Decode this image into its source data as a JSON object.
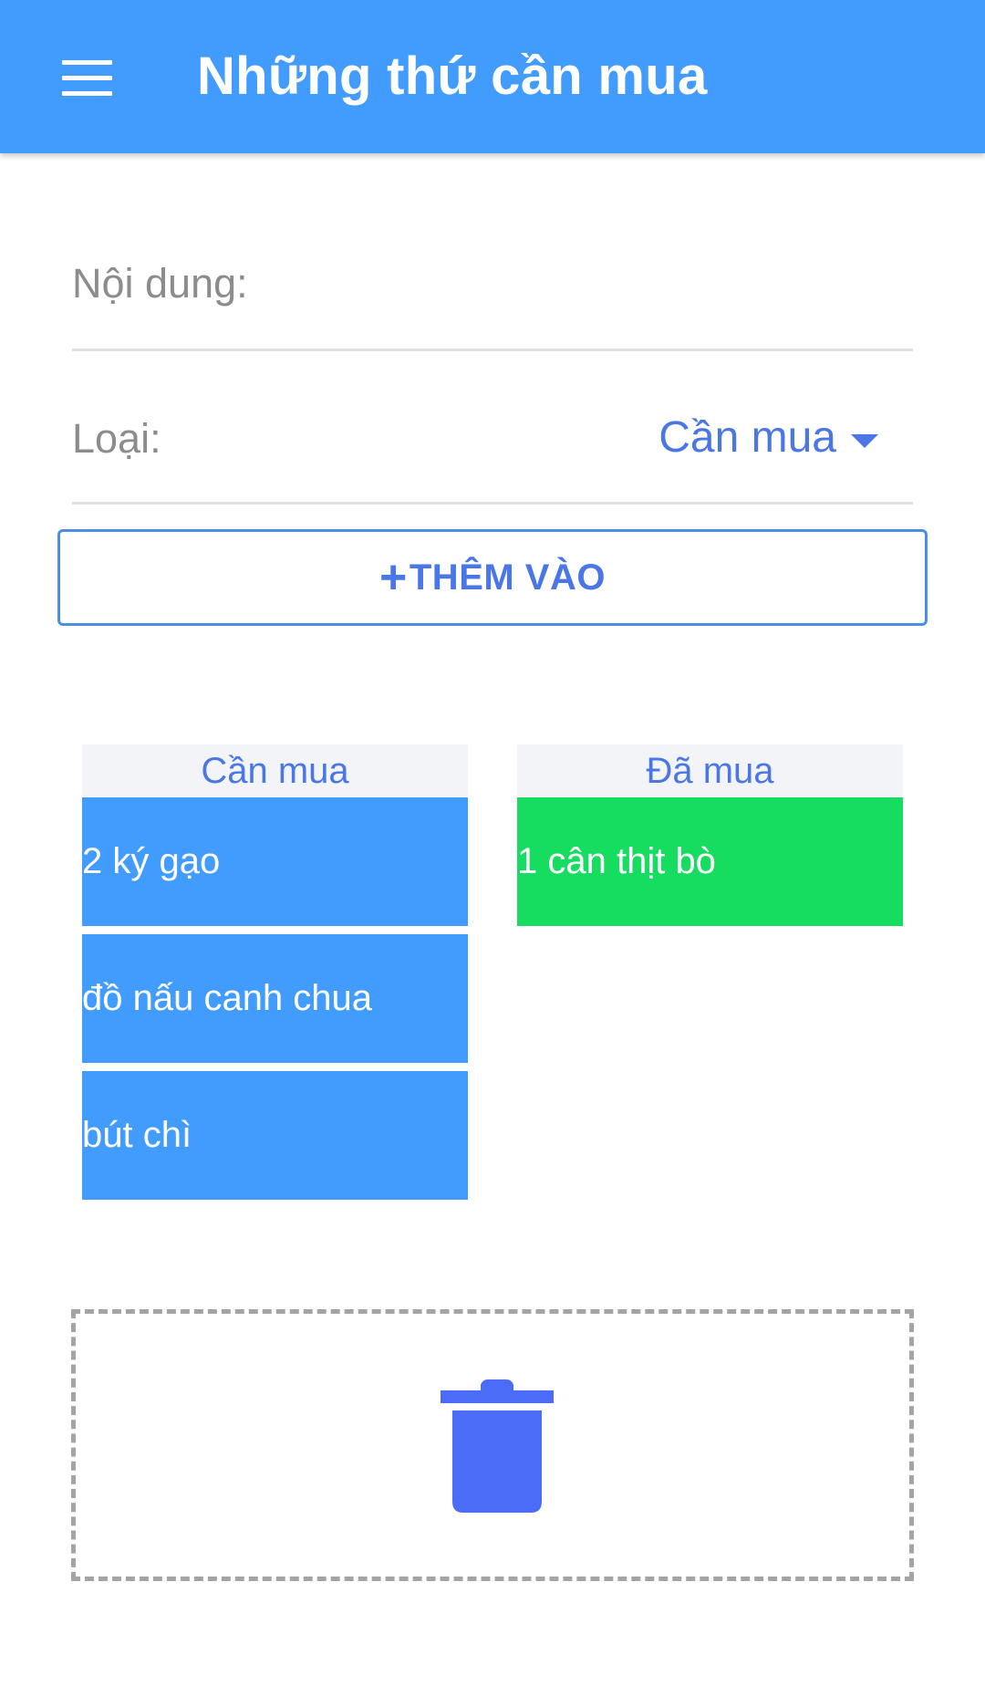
{
  "appbar": {
    "title": "Những thứ cần mua",
    "menu_icon": "hamburger-menu-icon",
    "color": "#429cfd"
  },
  "form": {
    "content_label": "Nội dung:",
    "content_value": "",
    "type_label": "Loại:",
    "type_selected": "Cần mua",
    "add_button": {
      "icon": "+",
      "label": "THÊM VÀO"
    }
  },
  "lists": {
    "to_buy": {
      "header": "Cần mua",
      "color": "#429cfd",
      "items": [
        "2 ký gạo",
        "đồ nấu canh chua",
        "bút chì"
      ]
    },
    "bought": {
      "header": "Đã mua",
      "color": "#16dc60",
      "items": [
        "1 cân thịt bò"
      ]
    }
  },
  "trash": {
    "icon": "trash-icon",
    "color": "#4a6cf7"
  }
}
